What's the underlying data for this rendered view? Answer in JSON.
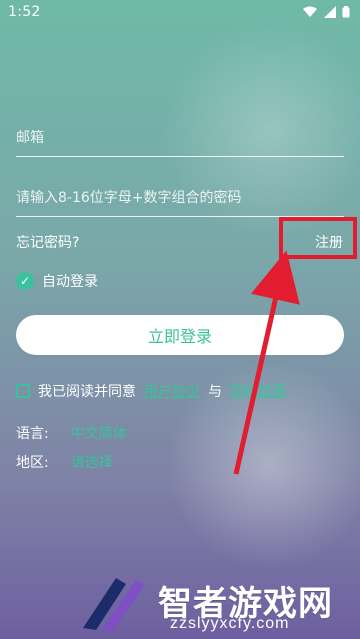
{
  "status_bar": {
    "time": "1:52"
  },
  "form": {
    "email_placeholder": "邮箱",
    "password_placeholder": "请输入8-16位字母+数字组合的密码",
    "forgot_password": "忘记密码?",
    "register": "注册",
    "auto_login_label": "自动登录",
    "login_button": "立即登录",
    "agreement": {
      "prefix": "我已阅读并同意",
      "user_agreement": "用户协议",
      "and": "与",
      "privacy_policy": "隐私政策"
    },
    "language": {
      "label": "语言:",
      "value": "中文简体"
    },
    "region": {
      "label": "地区:",
      "value": "请选择"
    }
  },
  "watermark": {
    "brand": "智者游戏网",
    "domain": "zzslyyxcfy.com"
  },
  "colors": {
    "accent": "#39c39c",
    "highlight": "#e11d2f"
  },
  "icons": {
    "status": [
      "wifi-icon",
      "signal-icon",
      "battery-icon"
    ],
    "checkbox_checked": "check-circle-icon",
    "checkbox_unchecked": "square-outline-icon"
  }
}
